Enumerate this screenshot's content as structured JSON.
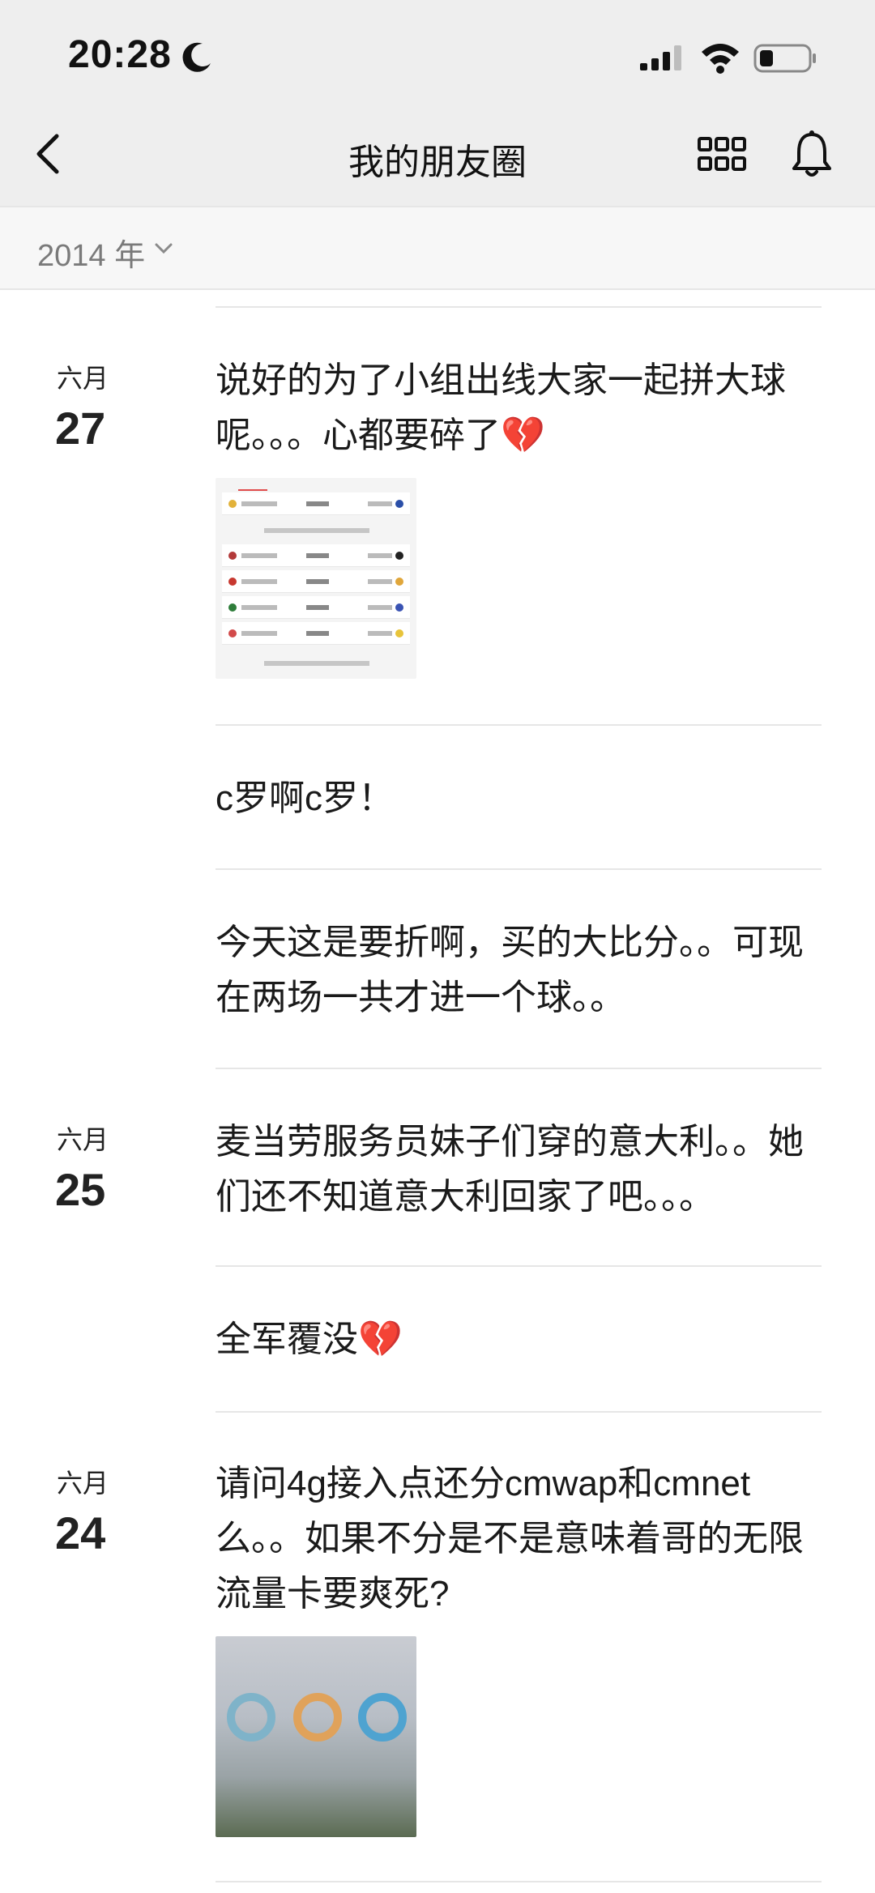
{
  "status_bar": {
    "time": "20:28",
    "icons": [
      "moon-icon",
      "signal-icon",
      "wifi-icon",
      "battery-icon"
    ]
  },
  "nav": {
    "title": "我的朋友圈",
    "back_icon": "chevron-left-icon",
    "grid_icon": "grid-icon",
    "bell_icon": "bell-icon"
  },
  "year_filter": {
    "label": "2014 年",
    "icon": "chevron-down-icon"
  },
  "posts": [
    {
      "month": "六月",
      "day": "27",
      "text": "说好的为了小组出线大家一起拼大球呢。。。心都要碎了💔",
      "has_image": true
    },
    {
      "month": "",
      "day": "",
      "text": "c罗啊c罗！",
      "has_image": false
    },
    {
      "month": "",
      "day": "",
      "text": "今天这是要折啊，买的大比分。。可现在两场一共才进一个球。。",
      "has_image": false
    },
    {
      "month": "六月",
      "day": "25",
      "text": "麦当劳服务员妹子们穿的意大利。。她们还不知道意大利回家了吧。。。",
      "has_image": false
    },
    {
      "month": "",
      "day": "",
      "text": "全军覆没💔",
      "has_image": false
    },
    {
      "month": "六月",
      "day": "24",
      "text": "请问4g接入点还分cmwap和cmnet么。。如果不分是不是意味着哥的无限流量卡要爽死?",
      "has_image": true
    }
  ],
  "colors": {
    "header_bg": "#eeeeee",
    "divider": "#e6e6e6",
    "muted_text": "#7a7a7a"
  }
}
